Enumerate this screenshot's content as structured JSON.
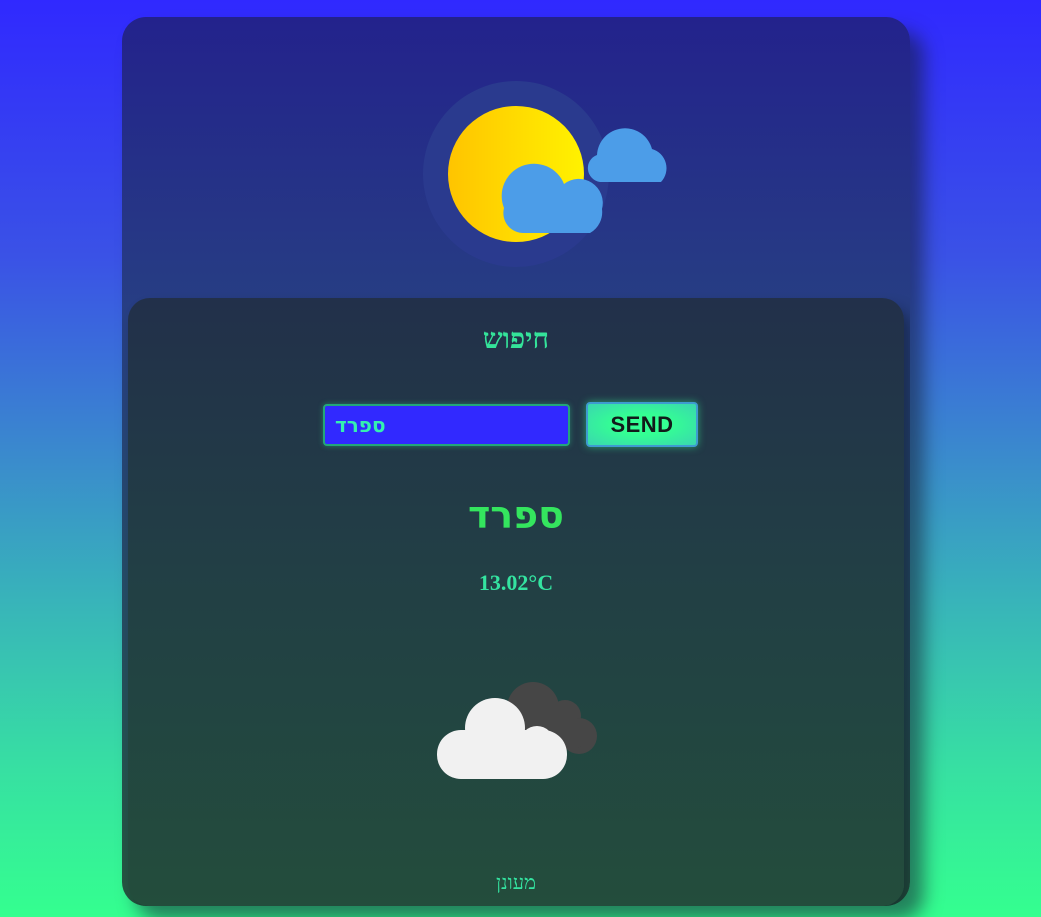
{
  "hero": {
    "icon": "sun-behind-clouds-icon"
  },
  "search": {
    "title": "חיפוש",
    "input_value": "ספרד",
    "send_label": "SEND"
  },
  "result": {
    "city": "ספרד",
    "temperature": "13.02°C",
    "weather_icon": "cloudy-icon",
    "description": "מעונן"
  },
  "colors": {
    "background_top": "#3029ff",
    "background_bottom": "#34ff8f",
    "accent_green": "#34e39a",
    "input_background": "#3129ff"
  }
}
